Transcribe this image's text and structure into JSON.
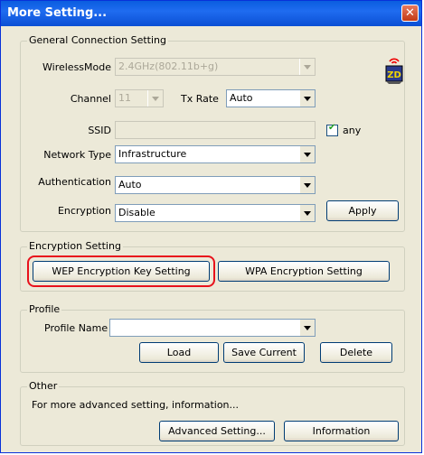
{
  "window": {
    "title": "More Setting...",
    "close_glyph": "✕"
  },
  "general": {
    "title": "General Connection Setting",
    "wireless_mode_label": "WirelessMode",
    "wireless_mode_value": "2.4GHz(802.11b+g)",
    "channel_label": "Channel",
    "channel_value": "11",
    "tx_rate_label": "Tx Rate",
    "tx_rate_value": "Auto",
    "ssid_label": "SSID",
    "ssid_value": "",
    "any_label": "any",
    "any_checked": true,
    "network_type_label": "Network Type",
    "network_type_value": "Infrastructure",
    "authentication_label": "Authentication",
    "authentication_value": "Auto",
    "encryption_label": "Encryption",
    "encryption_value": "Disable",
    "apply_label": "Apply",
    "logo_text": "ZD"
  },
  "encryption_setting": {
    "title": "Encryption Setting",
    "wep_label": "WEP Encryption Key Setting",
    "wpa_label": "WPA Encryption Setting"
  },
  "profile": {
    "title": "Profile",
    "name_label": "Profile Name",
    "name_value": "",
    "load_label": "Load",
    "save_label": "Save Current",
    "delete_label": "Delete"
  },
  "other": {
    "title": "Other",
    "description": "For more advanced setting, information...",
    "advanced_label": "Advanced Setting...",
    "information_label": "Information"
  },
  "colors": {
    "title_bar": "#0a5ddf",
    "dialog_bg": "#ece9d8",
    "highlight": "#e8121c"
  }
}
